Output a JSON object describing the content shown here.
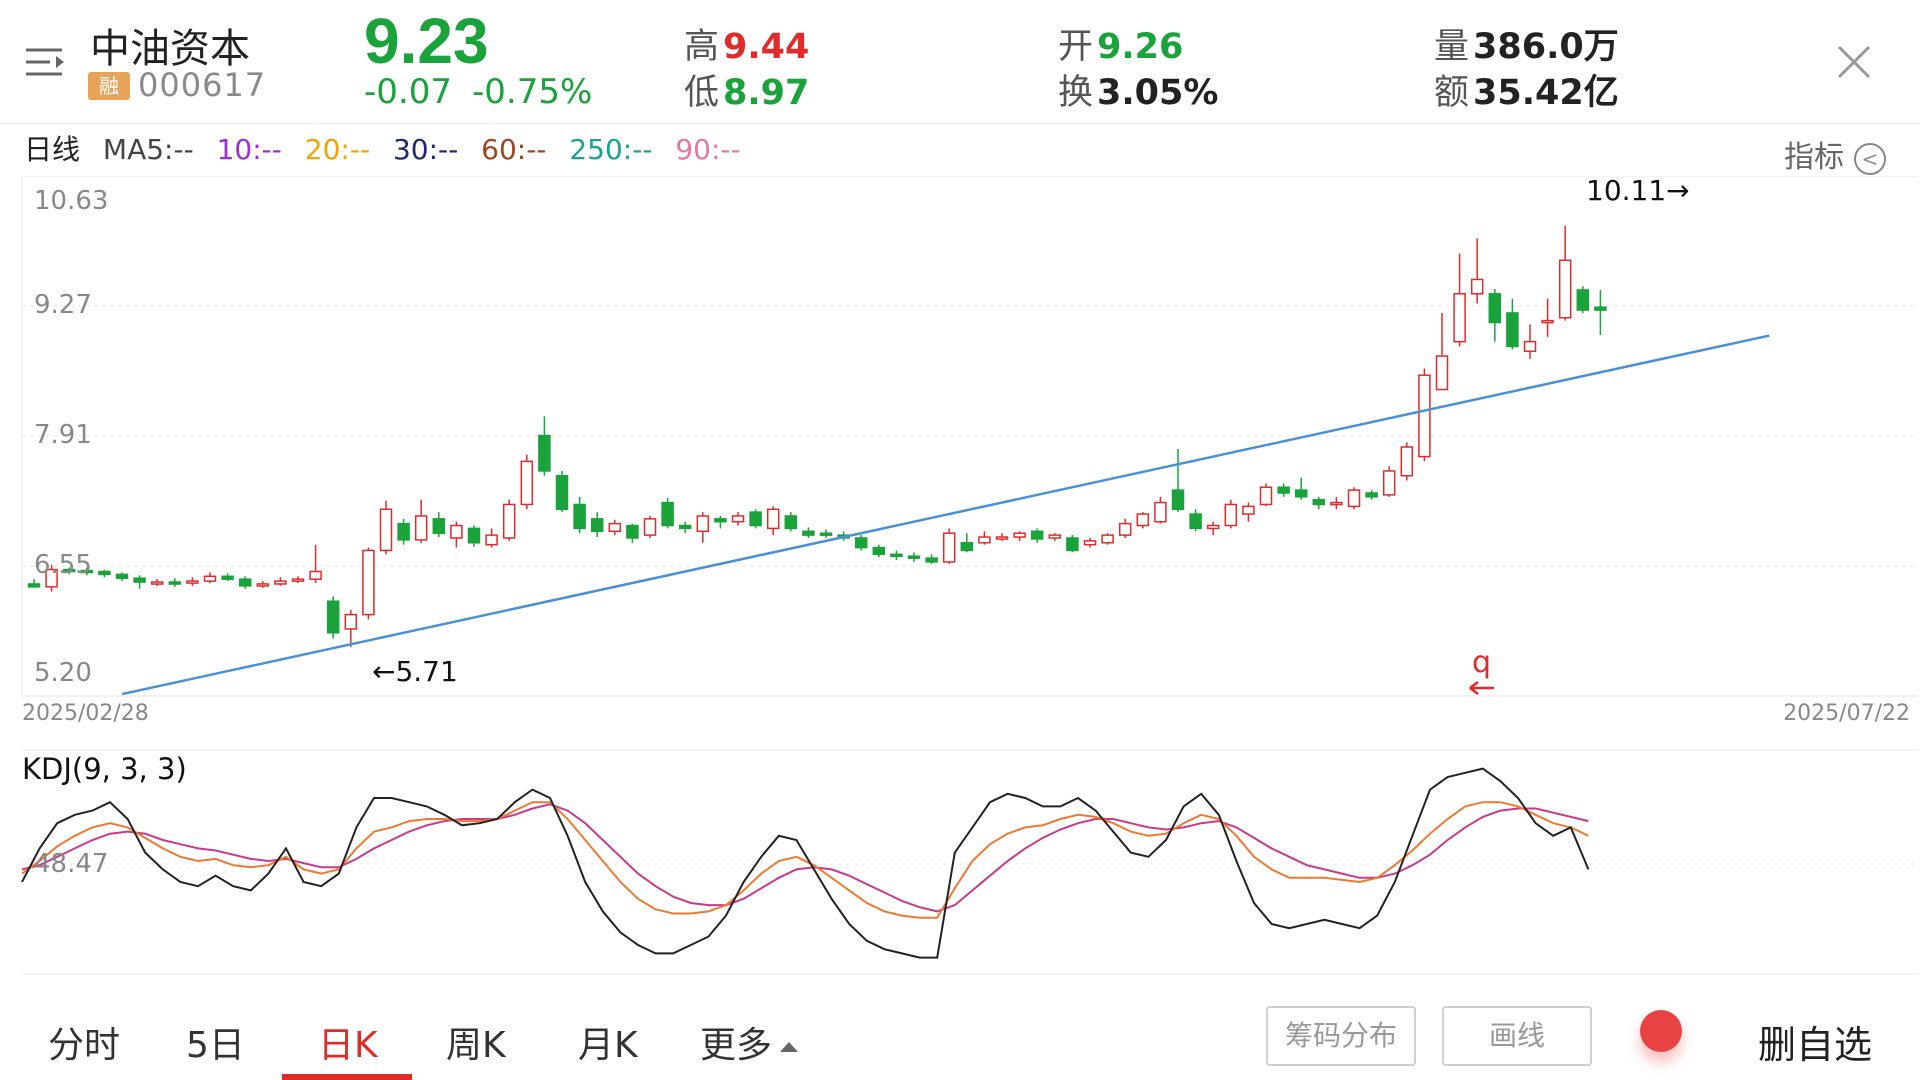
{
  "header": {
    "stock_name": "中油资本",
    "badge": "融",
    "stock_code": "000617",
    "price": "9.23",
    "change": "-0.07",
    "change_pct": "-0.75%",
    "high_label": "高",
    "high": "9.44",
    "low_label": "低",
    "low": "8.97",
    "open_label": "开",
    "open": "9.26",
    "turnover_label": "换",
    "turnover": "3.05%",
    "volume_label": "量",
    "volume": "386.0万",
    "amount_label": "额",
    "amount": "35.42亿",
    "price_color": "#1aa33a",
    "up_color": "#e02b2b",
    "down_color": "#1aa33a"
  },
  "ma_legend": {
    "period": "日线",
    "items": [
      {
        "text": "MA5:--",
        "color": "#333333"
      },
      {
        "text": "10:--",
        "color": "#9b30d9"
      },
      {
        "text": "20:--",
        "color": "#f0a500"
      },
      {
        "text": "30:--",
        "color": "#1f2a6e"
      },
      {
        "text": "60:--",
        "color": "#a0461f"
      },
      {
        "text": "250:--",
        "color": "#1aa38f"
      },
      {
        "text": "90:--",
        "color": "#e57aa0"
      }
    ],
    "indicator_label": "指标"
  },
  "kline": {
    "y_ticks": [
      "10.63",
      "9.27",
      "7.91",
      "6.55",
      "5.20"
    ],
    "date_start": "2025/02/28",
    "date_end": "2025/07/22",
    "high_marker": "10.11→",
    "low_marker": "←5.71",
    "q_marker": "q"
  },
  "chart_data": {
    "type": "candlestick",
    "start_date": "2025/02/28",
    "end_date": "2025/07/22",
    "ylim": [
      5.2,
      10.63
    ],
    "trendline": [
      [
        0,
        5.02
      ],
      [
        98,
        8.94
      ]
    ],
    "candles": [
      [
        6.37,
        6.34,
        6.42,
        6.33
      ],
      [
        6.34,
        6.52,
        6.57,
        6.29
      ],
      [
        6.52,
        6.51,
        6.54,
        6.47
      ],
      [
        6.51,
        6.5,
        6.54,
        6.46
      ],
      [
        6.5,
        6.47,
        6.52,
        6.44
      ],
      [
        6.47,
        6.43,
        6.49,
        6.4
      ],
      [
        6.43,
        6.39,
        6.46,
        6.32
      ],
      [
        6.39,
        6.39,
        6.42,
        6.35
      ],
      [
        6.39,
        6.38,
        6.43,
        6.34
      ],
      [
        6.38,
        6.4,
        6.44,
        6.35
      ],
      [
        6.4,
        6.45,
        6.49,
        6.38
      ],
      [
        6.45,
        6.42,
        6.48,
        6.4
      ],
      [
        6.42,
        6.35,
        6.45,
        6.32
      ],
      [
        6.35,
        6.37,
        6.4,
        6.33
      ],
      [
        6.37,
        6.4,
        6.44,
        6.35
      ],
      [
        6.4,
        6.42,
        6.45,
        6.38
      ],
      [
        6.42,
        6.5,
        6.78,
        6.38
      ],
      [
        6.19,
        5.86,
        6.24,
        5.8
      ],
      [
        5.9,
        6.05,
        6.1,
        5.71
      ],
      [
        6.05,
        6.72,
        6.75,
        6.0
      ],
      [
        6.72,
        7.15,
        7.24,
        6.68
      ],
      [
        7.0,
        6.83,
        7.05,
        6.78
      ],
      [
        6.83,
        7.08,
        7.25,
        6.8
      ],
      [
        7.05,
        6.9,
        7.12,
        6.86
      ],
      [
        6.85,
        6.98,
        7.02,
        6.75
      ],
      [
        6.95,
        6.8,
        6.98,
        6.76
      ],
      [
        6.78,
        6.88,
        6.95,
        6.75
      ],
      [
        6.85,
        7.2,
        7.25,
        6.82
      ],
      [
        7.2,
        7.65,
        7.72,
        7.15
      ],
      [
        7.92,
        7.55,
        8.12,
        7.5
      ],
      [
        7.5,
        7.15,
        7.55,
        7.12
      ],
      [
        7.2,
        6.95,
        7.28,
        6.9
      ],
      [
        7.05,
        6.92,
        7.12,
        6.86
      ],
      [
        6.92,
        7.0,
        7.04,
        6.88
      ],
      [
        6.98,
        6.85,
        7.0,
        6.8
      ],
      [
        6.88,
        7.05,
        7.08,
        6.85
      ],
      [
        7.22,
        6.98,
        7.27,
        6.95
      ],
      [
        6.98,
        6.95,
        7.02,
        6.9
      ],
      [
        6.92,
        7.08,
        7.12,
        6.8
      ],
      [
        7.05,
        7.02,
        7.08,
        6.95
      ],
      [
        7.02,
        7.08,
        7.12,
        6.98
      ],
      [
        7.12,
        6.98,
        7.15,
        6.95
      ],
      [
        6.95,
        7.15,
        7.18,
        6.88
      ],
      [
        7.08,
        6.95,
        7.12,
        6.92
      ],
      [
        6.92,
        6.88,
        6.96,
        6.85
      ],
      [
        6.9,
        6.88,
        6.94,
        6.85
      ],
      [
        6.88,
        6.85,
        6.92,
        6.82
      ],
      [
        6.85,
        6.75,
        6.88,
        6.72
      ],
      [
        6.75,
        6.68,
        6.78,
        6.65
      ],
      [
        6.68,
        6.66,
        6.72,
        6.62
      ],
      [
        6.66,
        6.64,
        6.7,
        6.6
      ],
      [
        6.64,
        6.6,
        6.68,
        6.58
      ],
      [
        6.6,
        6.9,
        6.95,
        6.58
      ],
      [
        6.8,
        6.72,
        6.9,
        6.7
      ],
      [
        6.8,
        6.86,
        6.92,
        6.78
      ],
      [
        6.85,
        6.86,
        6.9,
        6.82
      ],
      [
        6.86,
        6.9,
        6.92,
        6.82
      ],
      [
        6.92,
        6.84,
        6.95,
        6.8
      ],
      [
        6.85,
        6.88,
        6.9,
        6.82
      ],
      [
        6.85,
        6.72,
        6.88,
        6.7
      ],
      [
        6.78,
        6.82,
        6.85,
        6.75
      ],
      [
        6.8,
        6.88,
        6.9,
        6.78
      ],
      [
        6.88,
        7.0,
        7.05,
        6.85
      ],
      [
        6.98,
        7.1,
        7.12,
        6.95
      ],
      [
        7.02,
        7.22,
        7.28,
        7.0
      ],
      [
        7.35,
        7.15,
        7.78,
        7.12
      ],
      [
        7.1,
        6.95,
        7.15,
        6.92
      ],
      [
        6.95,
        6.98,
        7.02,
        6.88
      ],
      [
        6.98,
        7.2,
        7.25,
        6.95
      ],
      [
        7.1,
        7.18,
        7.22,
        7.02
      ],
      [
        7.2,
        7.38,
        7.42,
        7.18
      ],
      [
        7.38,
        7.32,
        7.42,
        7.28
      ],
      [
        7.35,
        7.28,
        7.48,
        7.25
      ],
      [
        7.25,
        7.2,
        7.28,
        7.15
      ],
      [
        7.2,
        7.22,
        7.28,
        7.15
      ],
      [
        7.18,
        7.35,
        7.38,
        7.15
      ],
      [
        7.32,
        7.28,
        7.35,
        7.25
      ],
      [
        7.3,
        7.55,
        7.6,
        7.28
      ],
      [
        7.5,
        7.8,
        7.85,
        7.45
      ],
      [
        7.7,
        8.55,
        8.62,
        7.65
      ],
      [
        8.4,
        8.75,
        9.2,
        8.4
      ],
      [
        8.9,
        9.4,
        9.82,
        8.85
      ],
      [
        9.4,
        9.55,
        9.98,
        9.3
      ],
      [
        9.4,
        9.1,
        9.45,
        8.9
      ],
      [
        9.2,
        8.85,
        9.35,
        8.82
      ],
      [
        8.8,
        8.9,
        9.08,
        8.72
      ],
      [
        9.1,
        9.12,
        9.35,
        8.95
      ],
      [
        9.15,
        9.75,
        10.11,
        9.12
      ],
      [
        9.44,
        9.23,
        9.48,
        9.2
      ],
      [
        9.26,
        9.23,
        9.44,
        8.97
      ]
    ],
    "kdj": {
      "label": "KDJ(9, 3, 3)",
      "y_tick": "48.47",
      "ylim": [
        0,
        100
      ],
      "k": [
        44,
        50,
        57,
        62,
        66,
        68,
        66,
        61,
        56,
        52,
        50,
        51,
        48,
        47,
        48,
        52,
        46,
        44,
        46,
        56,
        64,
        66,
        69,
        70,
        70,
        69,
        69,
        70,
        74,
        78,
        78,
        70,
        60,
        50,
        40,
        32,
        27,
        25,
        25,
        26,
        29,
        36,
        44,
        50,
        52,
        48,
        42,
        36,
        30,
        26,
        24,
        23,
        23,
        37,
        50,
        58,
        63,
        66,
        67,
        70,
        72,
        71,
        68,
        64,
        62,
        63,
        68,
        72,
        70,
        62,
        52,
        46,
        42,
        42,
        42,
        41,
        40,
        42,
        48,
        55,
        63,
        70,
        76,
        78,
        78,
        76,
        72,
        68,
        66,
        62
      ],
      "d": [
        46,
        48,
        52,
        56,
        60,
        63,
        64,
        63,
        60,
        58,
        56,
        55,
        53,
        51,
        50,
        51,
        49,
        47,
        47,
        51,
        56,
        60,
        64,
        67,
        69,
        70,
        70,
        70,
        72,
        75,
        77,
        74,
        68,
        60,
        52,
        44,
        38,
        33,
        30,
        29,
        29,
        32,
        37,
        42,
        46,
        47,
        46,
        43,
        39,
        35,
        31,
        28,
        26,
        29,
        36,
        43,
        50,
        56,
        61,
        65,
        68,
        70,
        70,
        68,
        66,
        65,
        66,
        68,
        69,
        66,
        61,
        56,
        52,
        48,
        46,
        44,
        42,
        42,
        44,
        48,
        53,
        60,
        66,
        71,
        74,
        75,
        75,
        73,
        71,
        69
      ],
      "j": [
        40,
        56,
        68,
        72,
        74,
        78,
        70,
        54,
        46,
        40,
        38,
        43,
        38,
        36,
        44,
        56,
        40,
        38,
        44,
        66,
        80,
        80,
        78,
        76,
        72,
        67,
        68,
        70,
        78,
        84,
        80,
        62,
        40,
        26,
        16,
        10,
        6,
        6,
        10,
        14,
        24,
        40,
        52,
        62,
        60,
        46,
        32,
        20,
        12,
        8,
        6,
        4,
        4,
        54,
        66,
        78,
        82,
        80,
        76,
        76,
        80,
        74,
        64,
        54,
        52,
        60,
        76,
        82,
        72,
        50,
        30,
        20,
        18,
        20,
        22,
        20,
        18,
        24,
        40,
        62,
        84,
        90,
        92,
        94,
        88,
        80,
        68,
        62,
        66,
        46
      ]
    }
  },
  "nav": {
    "tabs": [
      "分时",
      "5日",
      "日K",
      "周K",
      "月K",
      "更多"
    ],
    "active": "日K",
    "chip_distribution": "筹码分布",
    "draw_line": "画线",
    "delete_fav": "删自选"
  }
}
